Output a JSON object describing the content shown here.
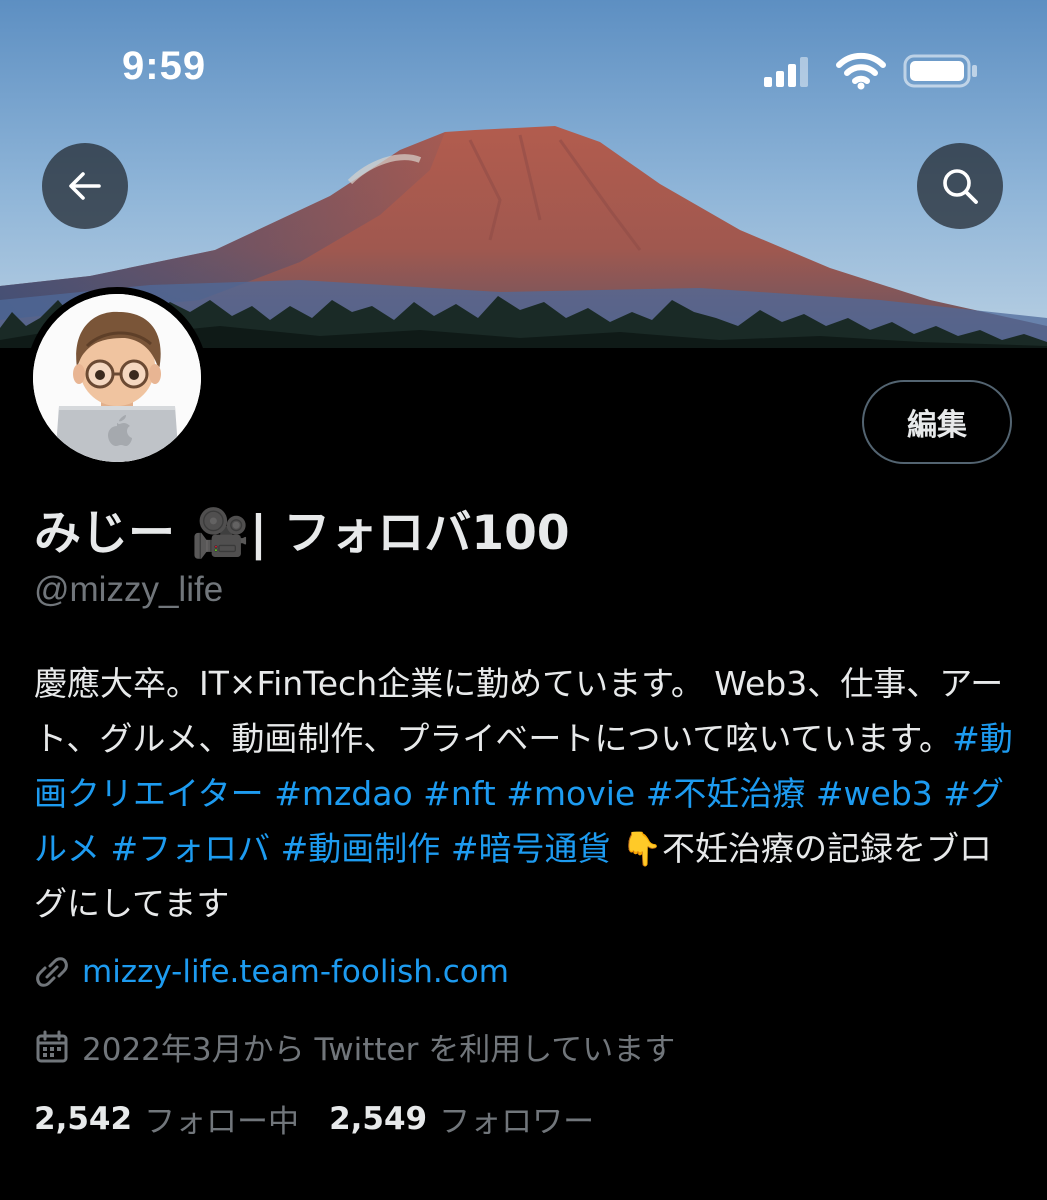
{
  "status_bar": {
    "time": "9:59"
  },
  "profile": {
    "display_name": "みじー 🎥| フォロバ100",
    "handle": "@mizzy_life",
    "edit_label": "編集",
    "bio": [
      {
        "text": "慶應大卒。IT×FinTech企業に勤めています。 Web3、仕事、アート、グルメ、動画制作、プライベートについて呟いています。",
        "tag": false
      },
      {
        "text": "#動画クリエイター",
        "tag": true
      },
      {
        "text": " ",
        "tag": false
      },
      {
        "text": "#mzdao",
        "tag": true
      },
      {
        "text": " ",
        "tag": false
      },
      {
        "text": "#nft",
        "tag": true
      },
      {
        "text": " ",
        "tag": false
      },
      {
        "text": "#movie",
        "tag": true
      },
      {
        "text": " ",
        "tag": false
      },
      {
        "text": "#不妊治療",
        "tag": true
      },
      {
        "text": " ",
        "tag": false
      },
      {
        "text": "#web3",
        "tag": true
      },
      {
        "text": " ",
        "tag": false
      },
      {
        "text": "#グルメ",
        "tag": true
      },
      {
        "text": " ",
        "tag": false
      },
      {
        "text": "#フォロバ",
        "tag": true
      },
      {
        "text": " ",
        "tag": false
      },
      {
        "text": "#動画制作",
        "tag": true
      },
      {
        "text": " ",
        "tag": false
      },
      {
        "text": "#暗号通貨",
        "tag": true
      },
      {
        "text": " 👇不妊治療の記録をブログにしてます",
        "tag": false
      }
    ],
    "website": "mizzy-life.team-foolish.com",
    "joined": "2022年3月から Twitter を利用しています",
    "following_count": "2,542",
    "following_label": "フォロー中",
    "followers_count": "2,549",
    "followers_label": "フォロワー"
  },
  "icons": {
    "back": "arrow-left-icon",
    "search": "search-icon",
    "link": "link-icon",
    "calendar": "calendar-icon"
  },
  "colors": {
    "accent": "#1d9bf0",
    "secondary_text": "#71767b",
    "background": "#000000"
  }
}
